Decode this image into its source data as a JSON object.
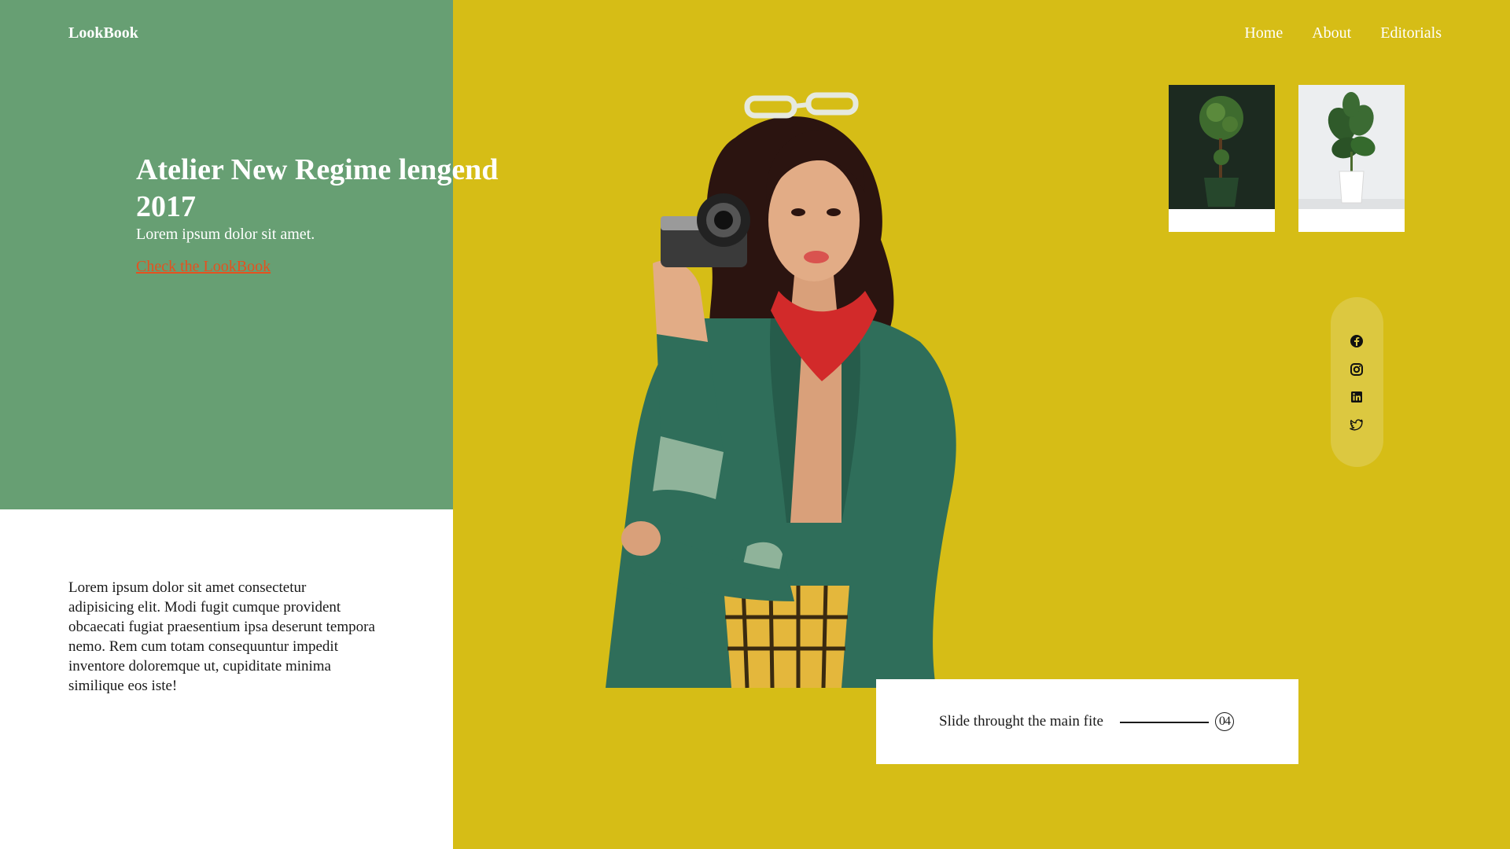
{
  "brand": "LookBook",
  "nav": {
    "items": [
      "Home",
      "About",
      "Editorials"
    ]
  },
  "hero": {
    "title": "Atelier New Regime lengend 2017",
    "subtitle": "Lorem ipsum dolor sit amet.",
    "link_label": "Check the LookBook"
  },
  "body_text": "Lorem ipsum dolor sit amet consectetur adipisicing elit. Modi fugit cumque provident obcaecati fugiat praesentium ipsa deserunt tempora nemo. Rem cum totam consequuntur impedit inventore doloremque ut, cupiditate minima similique eos iste!",
  "thumbnails": [
    {
      "icon": "topiary-plant-image"
    },
    {
      "icon": "fiddle-leaf-plant-image"
    }
  ],
  "social": {
    "icons": [
      "facebook-icon",
      "instagram-icon",
      "linkedin-icon",
      "twitter-icon"
    ]
  },
  "slider": {
    "label": "Slide throught the main fite",
    "number": "04"
  },
  "colors": {
    "green_panel": "#679f73",
    "yellow_background": "#d6bd16",
    "link": "#e5511f",
    "social_pill": "#dcc840"
  }
}
